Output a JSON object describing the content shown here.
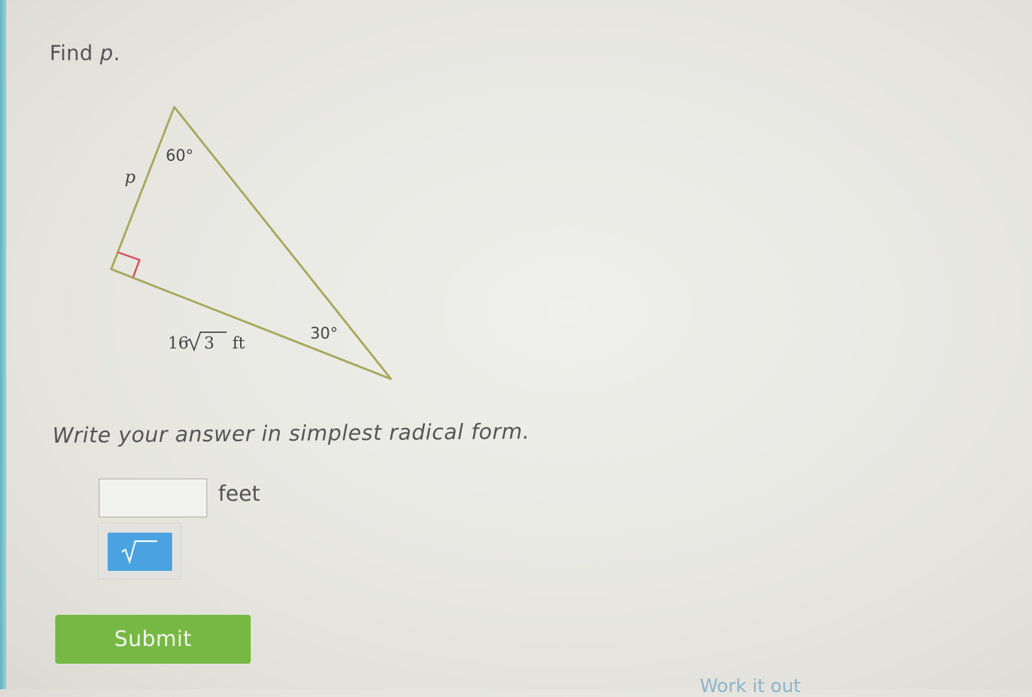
{
  "question": {
    "prompt_prefix": "Find ",
    "prompt_variable": "p",
    "prompt_suffix": "."
  },
  "figure": {
    "side_label": "p",
    "top_angle": "60°",
    "bottom_angle": "30°",
    "base_coefficient": "16",
    "base_radicand": "3",
    "base_unit": "ft",
    "colors": {
      "triangle_stroke": "#a8a85c",
      "right_angle_marker": "#d94a55"
    }
  },
  "instruction": "Write your answer in simplest radical form.",
  "answer": {
    "value": "",
    "placeholder": "",
    "unit": "feet"
  },
  "keypad": {
    "sqrt_icon": "square-root-icon",
    "color": "#4aa3e0"
  },
  "submit": {
    "label": "Submit",
    "color": "#76b843"
  },
  "footer": {
    "work_it_out": "Work it out"
  }
}
